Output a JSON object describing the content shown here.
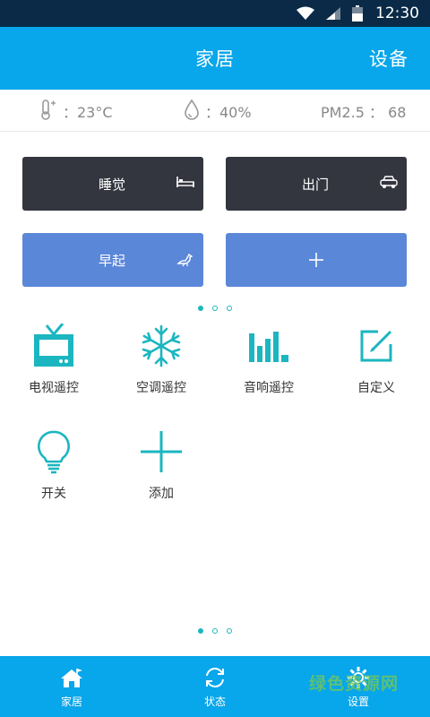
{
  "status_bar": {
    "time": "12:30",
    "icons": [
      "wifi-icon",
      "signal-icon",
      "battery-icon"
    ]
  },
  "header": {
    "title": "家居",
    "action": "设备"
  },
  "environment": {
    "temperature": "：23°C",
    "humidity": "：40%",
    "pm25": "PM2.5 ： 68"
  },
  "scenes": [
    {
      "label": "睡觉",
      "icon": "bed-icon"
    },
    {
      "label": "出门",
      "icon": "car-icon"
    },
    {
      "label": "早起",
      "icon": "bird-icon"
    },
    {
      "label": "+",
      "icon": "plus-icon"
    }
  ],
  "devices": [
    {
      "label": "电视遥控",
      "icon": "tv-icon"
    },
    {
      "label": "空调遥控",
      "icon": "snowflake-icon"
    },
    {
      "label": "音响遥控",
      "icon": "sound-bars-icon"
    },
    {
      "label": "自定义",
      "icon": "edit-icon"
    },
    {
      "label": "开关",
      "icon": "lightbulb-icon"
    },
    {
      "label": "添加",
      "icon": "plus-icon"
    }
  ],
  "bottom_nav": [
    {
      "label": "家居",
      "icon": "home-icon"
    },
    {
      "label": "状态",
      "icon": "refresh-icon"
    },
    {
      "label": "设置",
      "icon": "gear-icon"
    }
  ],
  "watermark": "绿色资源网",
  "colors": {
    "primary": "#08a6ea",
    "status_bar": "#0a2a47",
    "scene_dark": "#33353f",
    "scene_blue": "#5b87d8",
    "icon_teal": "#1bb6c0"
  }
}
